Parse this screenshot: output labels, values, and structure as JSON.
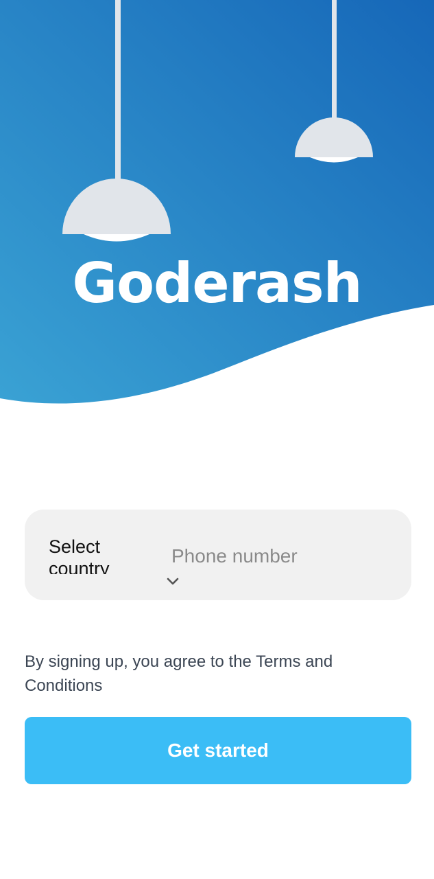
{
  "app": {
    "title": "Goderash"
  },
  "colors": {
    "gradient_start": "#3aa2d4",
    "gradient_end": "#1667b8",
    "lamp": "#e1e5ea",
    "button": "#3bbdf6",
    "card": "#f1f1f1"
  },
  "phone_form": {
    "country_select_label": "Select country",
    "phone_placeholder": "Phone number"
  },
  "terms_text": "By signing up, you agree to the Terms and Conditions",
  "cta": {
    "label": "Get started"
  }
}
